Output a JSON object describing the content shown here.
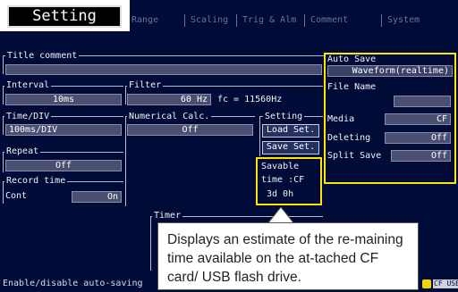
{
  "screen_title": "Setting",
  "tabs": [
    "Range",
    "Scaling",
    "Trig & Alm",
    "Comment",
    "System"
  ],
  "title_comment": {
    "label": "Title comment",
    "value": ""
  },
  "interval": {
    "label": "Interval",
    "value": "10ms"
  },
  "time_div": {
    "label": "Time/DIV",
    "value": "100ms/DIV"
  },
  "repeat": {
    "label": "Repeat",
    "value": "Off"
  },
  "record_time": {
    "label": "Record time",
    "mode": "Cont",
    "value": "On"
  },
  "filter": {
    "label": "Filter",
    "value": "60 Hz",
    "fc": "fc = 11560Hz"
  },
  "numerical_calc": {
    "label": "Numerical Calc.",
    "value": "Off"
  },
  "settings": {
    "label": "Setting",
    "load": "Load Set.",
    "save": "Save Set."
  },
  "savable": {
    "label": "Savable",
    "time_line": "time :CF",
    "value": "3d  0h"
  },
  "timer": {
    "label": "Timer"
  },
  "auto_save": {
    "label": "Auto Save",
    "value": "Waveform(realtime)",
    "file_name_label": "File Name",
    "file_name_value": "",
    "media_label": "Media",
    "media_value": "CF",
    "deleting_label": "Deleting",
    "deleting_value": "Off",
    "split_save_label": "Split Save",
    "split_save_value": "Off"
  },
  "status_text": "Enable/disable auto-saving",
  "status_icons": "CF USB",
  "callout_text": "Displays an estimate of the re-maining time available on the at-tached CF card/ USB flash drive.",
  "colors": {
    "screen_bg": "#000b38",
    "highlight": "#ffe600",
    "field_bg": "#4a4f72"
  }
}
